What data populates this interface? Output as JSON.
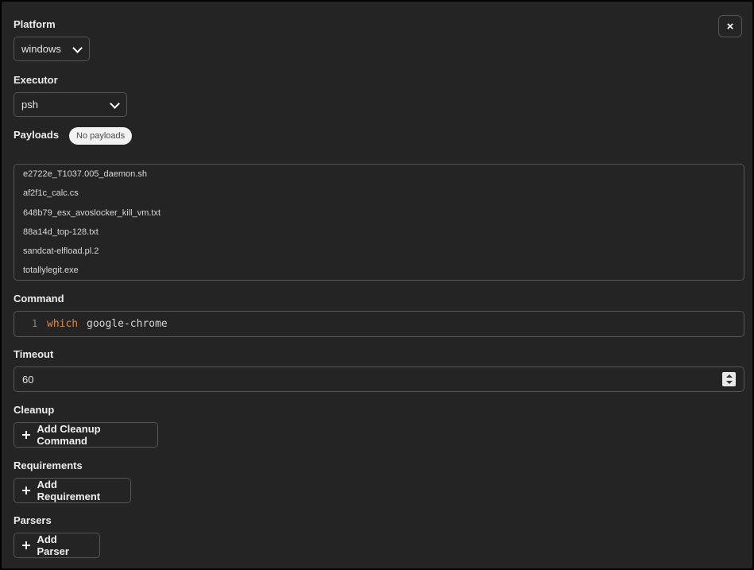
{
  "close_label": "×",
  "platform": {
    "label": "Platform",
    "value": "windows"
  },
  "executor": {
    "label": "Executor",
    "value": "psh"
  },
  "payloads": {
    "label": "Payloads",
    "badge": "No payloads",
    "items": [
      "e2722e_T1037.005_daemon.sh",
      "af2f1c_calc.cs",
      "648b79_esx_avoslocker_kill_vm.txt",
      "88a14d_top-128.txt",
      "sandcat-elfload.pl.2",
      "totallylegit.exe"
    ]
  },
  "command": {
    "label": "Command",
    "line_number": "1",
    "keyword": "which",
    "rest": "google-chrome"
  },
  "timeout": {
    "label": "Timeout",
    "value": "60"
  },
  "cleanup": {
    "label": "Cleanup",
    "button": "Add Cleanup Command"
  },
  "requirements": {
    "label": "Requirements",
    "button": "Add Requirement"
  },
  "parsers": {
    "label": "Parsers",
    "button": "Add Parser"
  },
  "colors": {
    "background": "#242424",
    "keyword": "#d98a4a",
    "border": "#555555",
    "badge_bg": "#f2f2f2"
  }
}
